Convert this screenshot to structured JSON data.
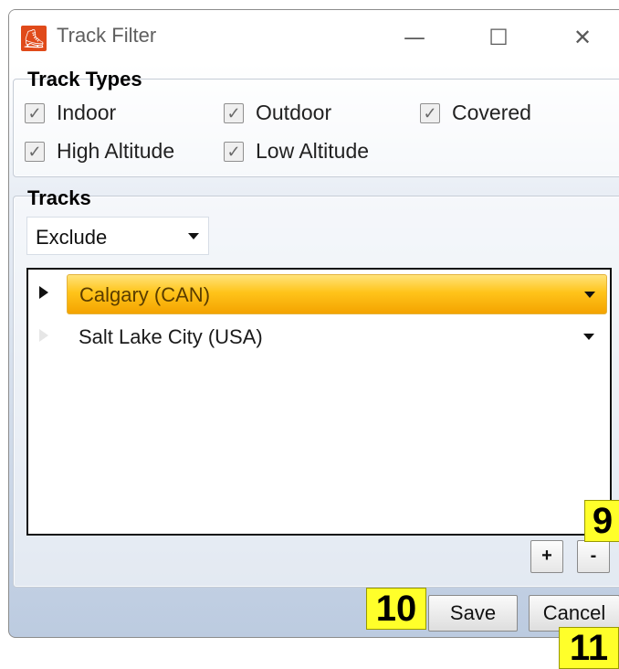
{
  "window": {
    "title": "Track Filter",
    "app_icon_glyph": "skater-icon",
    "controls": {
      "minimize": "—",
      "maximize": "☐",
      "close": "✕"
    }
  },
  "track_types": {
    "label": "Track Types",
    "options": [
      {
        "label": "Indoor",
        "checked": true
      },
      {
        "label": "Outdoor",
        "checked": true
      },
      {
        "label": "Covered",
        "checked": true
      },
      {
        "label": "High Altitude",
        "checked": true
      },
      {
        "label": "Low Altitude",
        "checked": true
      }
    ]
  },
  "tracks": {
    "label": "Tracks",
    "mode": "Exclude",
    "rows": [
      {
        "name": "Calgary (CAN)",
        "selected": true
      },
      {
        "name": "Salt Lake City (USA)",
        "selected": false
      }
    ],
    "add_label": "+",
    "remove_label": "-"
  },
  "footer": {
    "save_label": "Save",
    "cancel_label": "Cancel"
  },
  "markers": [
    "9",
    "10",
    "11"
  ],
  "colors": {
    "selection": "#ffc41a",
    "marker": "#ffff2a",
    "app_icon": "#e04a1a"
  }
}
